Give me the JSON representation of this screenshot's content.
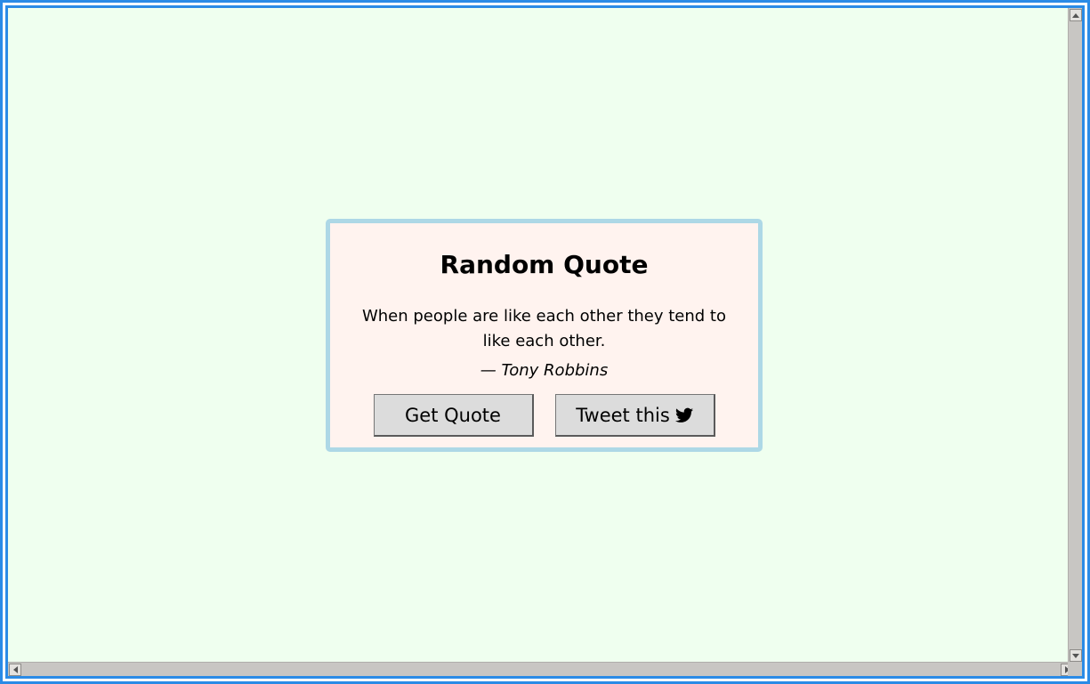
{
  "card": {
    "title": "Random Quote",
    "quote": "When people are like each other they tend to like each other.",
    "author": "— Tony Robbins"
  },
  "buttons": {
    "get_quote": "Get Quote",
    "tweet": "Tweet this"
  },
  "icons": {
    "tweet": "twitter-bird-icon"
  },
  "colors": {
    "page_background": "#efffef",
    "card_background": "#fff3ef",
    "card_border": "#add8e6",
    "window_border": "#2b8be6",
    "button_background": "#dcdcdc"
  }
}
